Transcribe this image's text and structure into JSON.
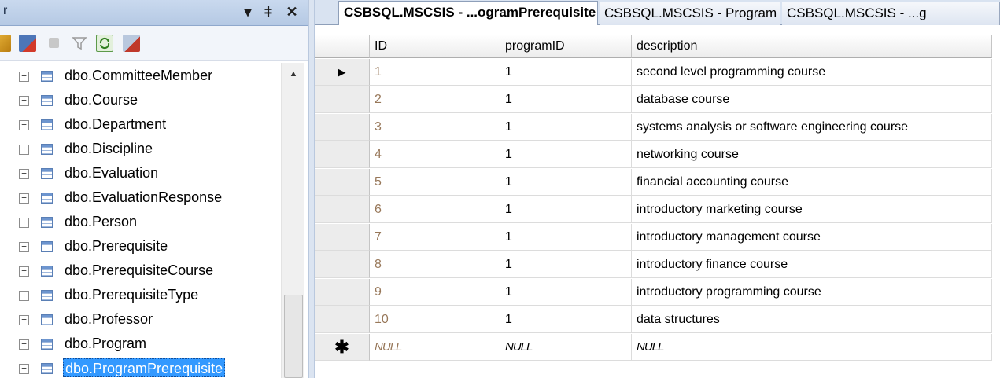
{
  "object_explorer": {
    "title": "r",
    "title_buttons": {
      "dropdown": "▾",
      "pin": "ǂ",
      "close": "✕"
    },
    "toolbar_icons": [
      "connect-icon",
      "disconnect-icon",
      "stop-icon",
      "filter-icon",
      "refresh-icon",
      "summary-icon"
    ],
    "tree_items": [
      {
        "label": "dbo.CommitteeMember",
        "expander": "+",
        "selected": false
      },
      {
        "label": "dbo.Course",
        "expander": "+",
        "selected": false
      },
      {
        "label": "dbo.Department",
        "expander": "+",
        "selected": false
      },
      {
        "label": "dbo.Discipline",
        "expander": "+",
        "selected": false
      },
      {
        "label": "dbo.Evaluation",
        "expander": "+",
        "selected": false
      },
      {
        "label": "dbo.EvaluationResponse",
        "expander": "+",
        "selected": false
      },
      {
        "label": "dbo.Person",
        "expander": "+",
        "selected": false
      },
      {
        "label": "dbo.Prerequisite",
        "expander": "+",
        "selected": false
      },
      {
        "label": "dbo.PrerequisiteCourse",
        "expander": "+",
        "selected": false
      },
      {
        "label": "dbo.PrerequisiteType",
        "expander": "+",
        "selected": false
      },
      {
        "label": "dbo.Professor",
        "expander": "+",
        "selected": false
      },
      {
        "label": "dbo.Program",
        "expander": "+",
        "selected": false
      },
      {
        "label": "dbo.ProgramPrerequisite",
        "expander": "+",
        "selected": true
      }
    ],
    "scroll_up_glyph": "▲"
  },
  "tabs": [
    {
      "label": "CSBSQL.MSCSIS - ...ogramPrerequisite",
      "active": true
    },
    {
      "label": "CSBSQL.MSCSIS - Program",
      "active": false
    },
    {
      "label": "CSBSQL.MSCSIS - ...g",
      "active": false
    }
  ],
  "grid": {
    "columns": [
      "ID",
      "programID",
      "description"
    ],
    "current_row_glyph": "▶",
    "new_row_glyph": "✱",
    "rows": [
      {
        "id": "1",
        "programID": "1",
        "description": "second level programming course"
      },
      {
        "id": "2",
        "programID": "1",
        "description": "database course"
      },
      {
        "id": "3",
        "programID": "1",
        "description": "systems analysis or software engineering course"
      },
      {
        "id": "4",
        "programID": "1",
        "description": "networking course"
      },
      {
        "id": "5",
        "programID": "1",
        "description": "financial accounting course"
      },
      {
        "id": "6",
        "programID": "1",
        "description": "introductory marketing course"
      },
      {
        "id": "7",
        "programID": "1",
        "description": "introductory management course"
      },
      {
        "id": "8",
        "programID": "1",
        "description": "introductory finance course"
      },
      {
        "id": "9",
        "programID": "1",
        "description": "introductory programming course"
      },
      {
        "id": "10",
        "programID": "1",
        "description": "data structures"
      }
    ],
    "new_row": {
      "id": "NULL",
      "programID": "NULL",
      "description": "NULL"
    }
  },
  "colors": {
    "selection": "#3399ff",
    "id_text": "#98785a",
    "titlebar": "#c9d9ee"
  }
}
